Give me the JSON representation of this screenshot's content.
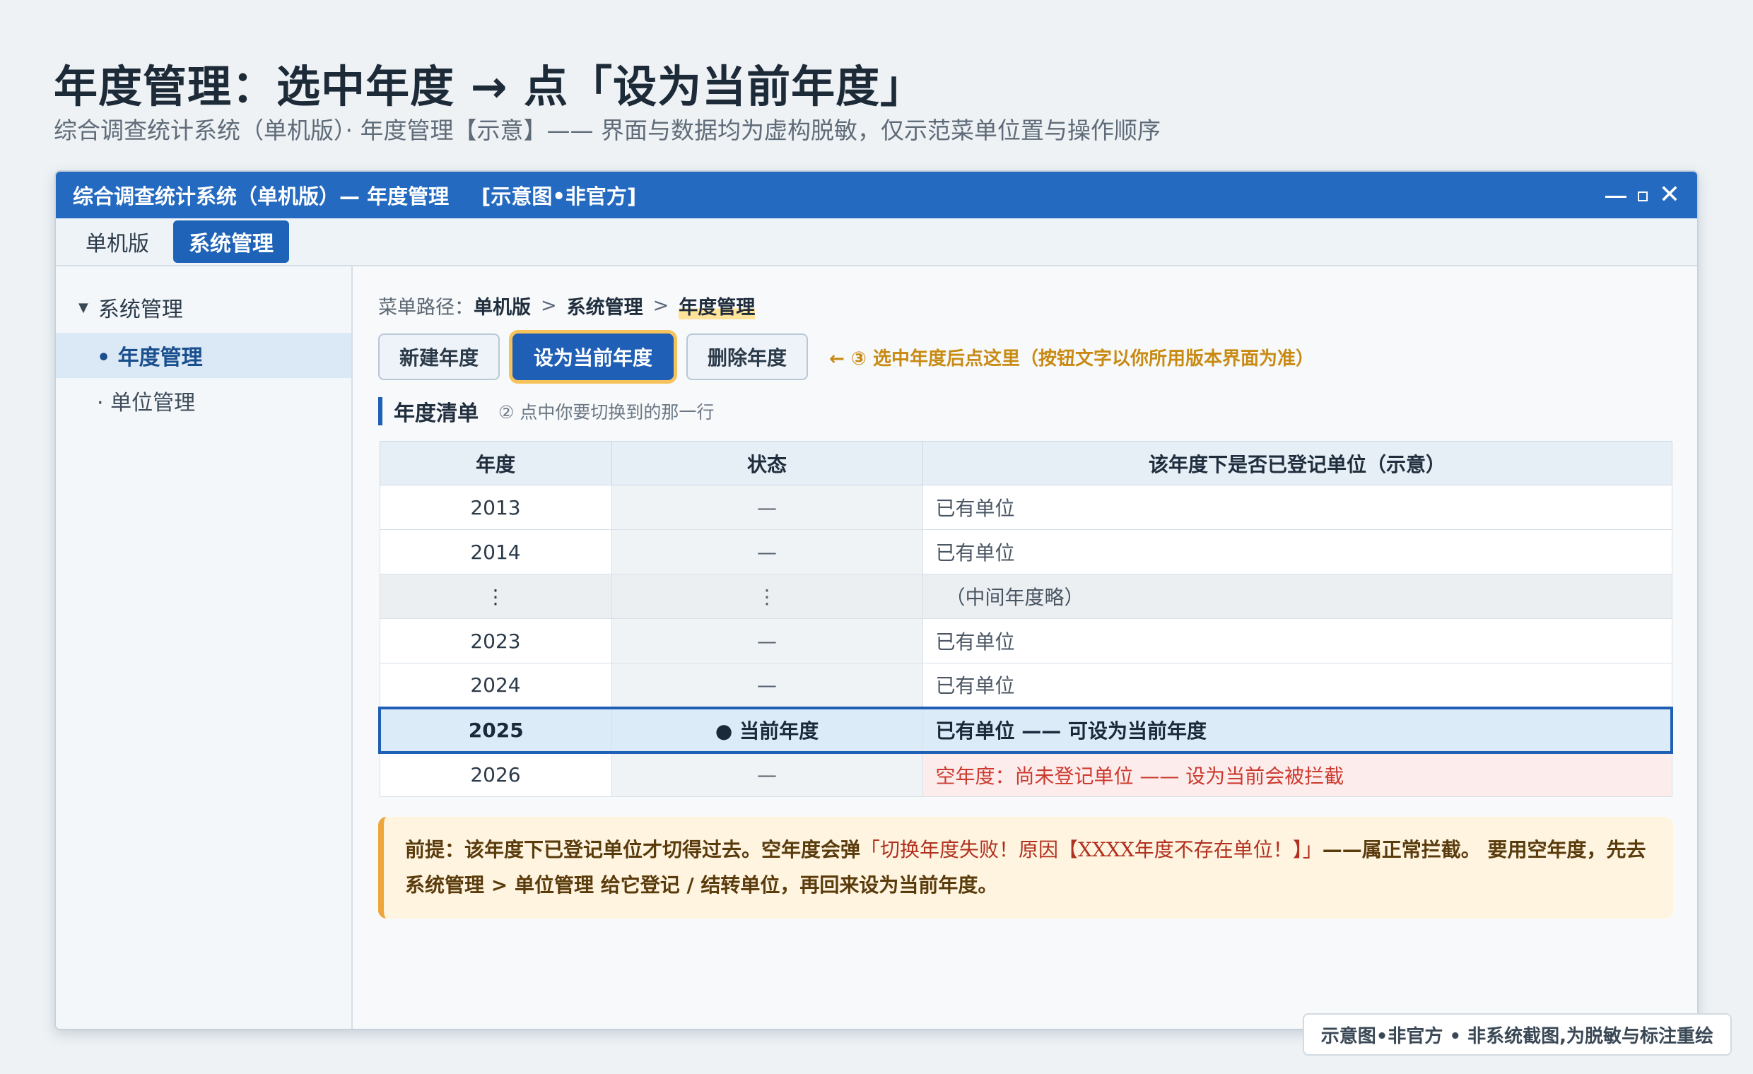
{
  "page": {
    "title": "年度管理：选中年度 → 点「设为当前年度」",
    "subtitle": "综合调查统计系统（单机版）· 年度管理【示意】—— 界面与数据均为虚构脱敏，仅示范菜单位置与操作顺序"
  },
  "window": {
    "title": "综合调查统计系统（单机版）— 年度管理",
    "tag": "[示意图•非官方]"
  },
  "menubar": {
    "tabs": [
      {
        "label": "单机版"
      },
      {
        "label": "系统管理"
      }
    ]
  },
  "sidebar": {
    "root": "系统管理",
    "items": [
      {
        "label": "• 年度管理"
      },
      {
        "label": "· 单位管理"
      }
    ]
  },
  "breadcrumb": {
    "label": "菜单路径：",
    "segments": [
      "单机版",
      "系统管理",
      "年度管理"
    ],
    "separator": ">"
  },
  "toolbar": {
    "new_label": "新建年度",
    "set_current_label": "设为当前年度",
    "delete_label": "删除年度",
    "hint": "← ③ 选中年度后点这里（按钮文字以你所用版本界面为准）"
  },
  "section": {
    "title": "年度清单",
    "hint": "② 点中你要切换到的那一行"
  },
  "table": {
    "columns": [
      "年度",
      "状态",
      "该年度下是否已登记单位（示意）"
    ],
    "rows": [
      {
        "year": "2013",
        "status": "—",
        "note": "已有单位"
      },
      {
        "year": "2014",
        "status": "—",
        "note": "已有单位"
      },
      {
        "year": "⋮",
        "status": "⋮",
        "note": "（中间年度略）"
      },
      {
        "year": "2023",
        "status": "—",
        "note": "已有单位"
      },
      {
        "year": "2024",
        "status": "—",
        "note": "已有单位"
      },
      {
        "year": "2025",
        "status": "● 当前年度",
        "note": "已有单位 —— 可设为当前年度"
      },
      {
        "year": "2026",
        "status": "—",
        "note": "空年度：尚未登记单位 —— 设为当前会被拦截"
      }
    ]
  },
  "notice": {
    "part1": "前提：该年度下已登记单位才切得过去。空年度会弹",
    "quote": "「切换年度失败！原因【XXXX年度不存在单位！】」",
    "part2": "——属正常拦截。 要用空年度，先去 系统管理 > 单位管理 给它登记 / 结转单位，再回来设为当前年度。"
  },
  "watermark": "示意图•非官方 • 非系统截图,为脱敏与标注重绘",
  "colors": {
    "titlebar": "#246ac0",
    "primary_button": "#1f5fb5",
    "highlight_ring": "#f6c25a",
    "hint_text": "#c98a12",
    "error_text": "#cc3a2e",
    "notice_bg": "#fff4e0"
  }
}
